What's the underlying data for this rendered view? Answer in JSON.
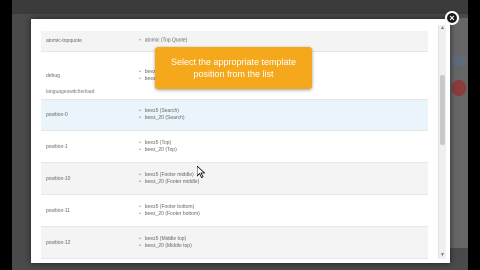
{
  "tooltip": {
    "text": "Select the appropriate template position from the list"
  },
  "close_glyph": "×",
  "section_label": "languageswitcherload",
  "rows": [
    {
      "name": "atomic-topquote",
      "values": [
        "atomic (Top Quote)"
      ]
    },
    {
      "name": "debug",
      "values": [
        "beez5",
        "beez_20"
      ]
    },
    {
      "name": "position-0",
      "values": [
        "beez5 (Search)",
        "beez_20 (Search)"
      ]
    },
    {
      "name": "position-1",
      "values": [
        "beez5 (Top)",
        "beez_20 (Top)"
      ]
    },
    {
      "name": "position-10",
      "values": [
        "beez5 (Footer middle)",
        "beez_20 (Footer middle)"
      ]
    },
    {
      "name": "position-11",
      "values": [
        "beez5 (Footer bottom)",
        "beez_20 (Footer bottom)"
      ]
    },
    {
      "name": "position-12",
      "values": [
        "beez5 (Middle top)",
        "beez_20 (Middle top)"
      ]
    }
  ],
  "scrollbar": {
    "up_glyph": "▲",
    "down_glyph": "▼"
  }
}
